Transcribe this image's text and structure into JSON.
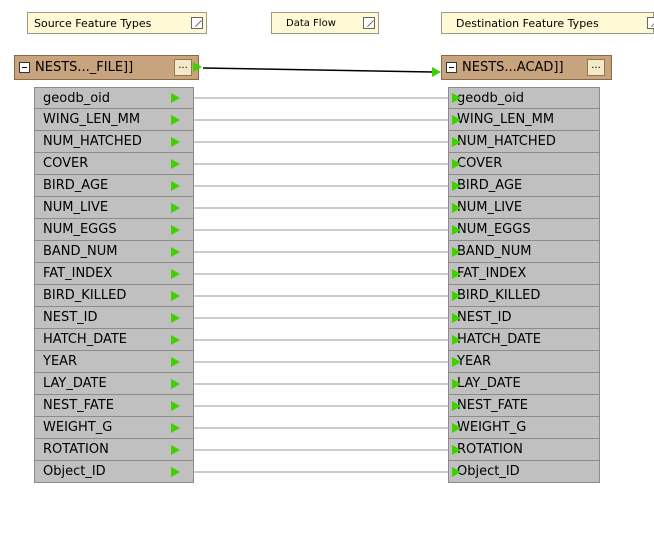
{
  "bookmarks": {
    "source": "Source Feature Types",
    "dataflow": "Data Flow",
    "destination": "Destination Feature Types"
  },
  "source": {
    "title": "NESTS..._FILE]]",
    "button": "..."
  },
  "destination": {
    "title": "NESTS...ACAD]]",
    "button": "..."
  },
  "attributes": [
    {
      "src": "geodb_oid",
      "dst": "geodb_oid"
    },
    {
      "src": "WING_LEN_MM",
      "dst": "WING_LEN_MM"
    },
    {
      "src": "NUM_HATCHED",
      "dst": "NUM_HATCHED"
    },
    {
      "src": "COVER",
      "dst": "COVER"
    },
    {
      "src": "BIRD_AGE",
      "dst": "BIRD_AGE"
    },
    {
      "src": "NUM_LIVE",
      "dst": "NUM_LIVE"
    },
    {
      "src": "NUM_EGGS",
      "dst": "NUM_EGGS"
    },
    {
      "src": "BAND_NUM",
      "dst": "BAND_NUM"
    },
    {
      "src": "FAT_INDEX",
      "dst": "FAT_INDEX"
    },
    {
      "src": "BIRD_KILLED",
      "dst": "BIRD_KILLED"
    },
    {
      "src": "NEST_ID",
      "dst": "NEST_ID"
    },
    {
      "src": "HATCH_DATE",
      "dst": "HATCH_DATE"
    },
    {
      "src": "YEAR",
      "dst": "YEAR"
    },
    {
      "src": "LAY_DATE",
      "dst": "LAY_DATE"
    },
    {
      "src": "NEST_FATE",
      "dst": "NEST_FATE"
    },
    {
      "src": "WEIGHT_G",
      "dst": "WEIGHT_G"
    },
    {
      "src": "ROTATION",
      "dst": "ROTATION"
    },
    {
      "src": "Object_ID",
      "dst": "Object_ID"
    }
  ],
  "colors": {
    "port_arrow": "#3fd200",
    "header": "#c8a47e",
    "attribute_row": "#c0c0c0",
    "bookmark": "#fff9d6"
  }
}
